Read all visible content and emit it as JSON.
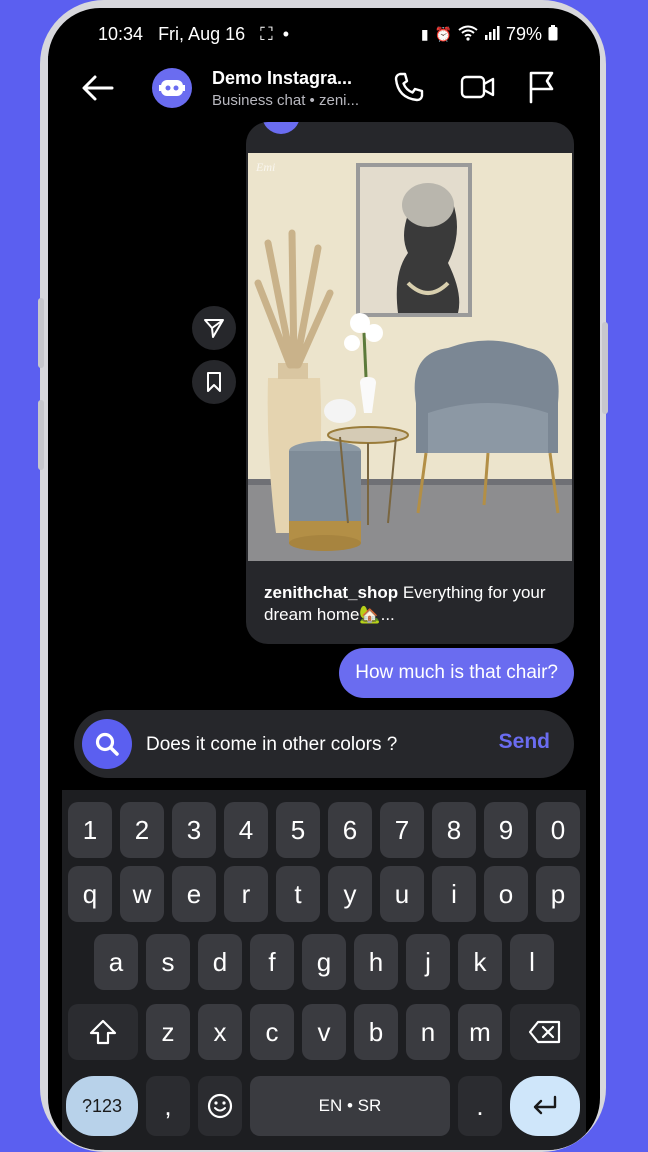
{
  "status": {
    "time": "10:34",
    "date": "Fri, Aug 16",
    "battery": "79%"
  },
  "header": {
    "title": "Demo Instagra...",
    "subtitle": "Business chat • zeni..."
  },
  "message": {
    "caption_user": "zenithchat_shop",
    "caption_text": " Everything for your dream home🏡...",
    "outgoing": "How much is that chair?"
  },
  "composer": {
    "value": "Does it come in other colors ?",
    "send_label": "Send"
  },
  "keyboard": {
    "row_numbers": [
      "1",
      "2",
      "3",
      "4",
      "5",
      "6",
      "7",
      "8",
      "9",
      "0"
    ],
    "row1": [
      "q",
      "w",
      "e",
      "r",
      "t",
      "y",
      "u",
      "i",
      "o",
      "p"
    ],
    "row2": [
      "a",
      "s",
      "d",
      "f",
      "g",
      "h",
      "j",
      "k",
      "l"
    ],
    "row3": [
      "z",
      "x",
      "c",
      "v",
      "b",
      "n",
      "m"
    ],
    "sym_label": "?123",
    "comma": ",",
    "space_label": "EN • SR",
    "period": "."
  },
  "colors": {
    "accent": "#5b5ff0",
    "bubble": "#6a6cf0",
    "background": "#000000",
    "card": "#26272b"
  }
}
